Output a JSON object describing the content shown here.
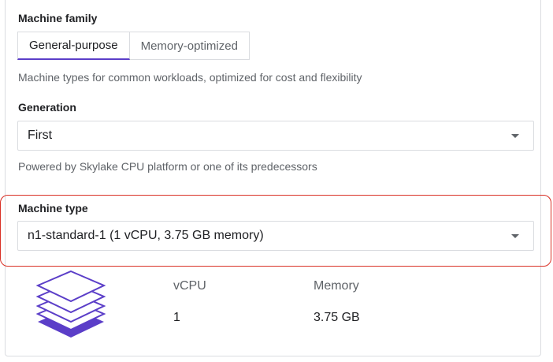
{
  "machine_family": {
    "label": "Machine family",
    "tabs": [
      {
        "label": "General-purpose",
        "active": true
      },
      {
        "label": "Memory-optimized",
        "active": false
      }
    ],
    "description": "Machine types for common workloads, optimized for cost and flexibility"
  },
  "generation": {
    "label": "Generation",
    "value": "First",
    "description": "Powered by Skylake CPU platform or one of its predecessors"
  },
  "machine_type": {
    "label": "Machine type",
    "value": "n1-standard-1 (1 vCPU, 3.75 GB memory)"
  },
  "specs": {
    "vcpu_label": "vCPU",
    "vcpu_value": "1",
    "memory_label": "Memory",
    "memory_value": "3.75 GB"
  },
  "colors": {
    "accent": "#5b3ec8",
    "highlight": "#d93025",
    "icon": "#5b3ec8"
  },
  "icons": {
    "machine_icon": "stacked-layers-icon"
  }
}
